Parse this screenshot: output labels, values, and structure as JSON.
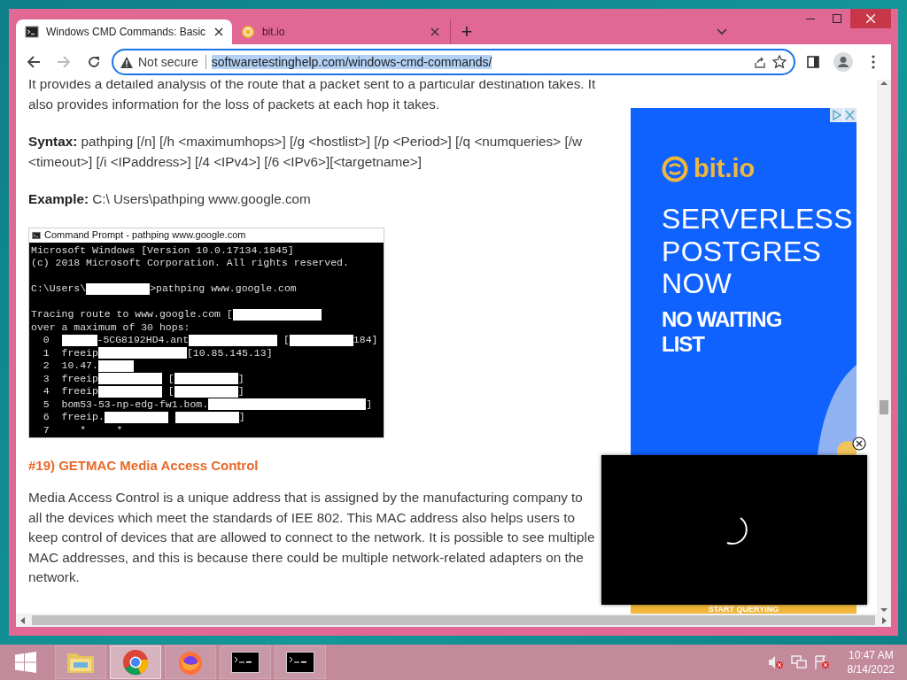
{
  "browser": {
    "tabs": [
      {
        "title": "Windows CMD Commands: Basic",
        "selected": true
      },
      {
        "title": "bit.io",
        "selected": false
      }
    ],
    "new_tab": "+",
    "address_bar": {
      "security": "Not secure",
      "url": "softwaretestinghelp.com/windows-cmd-commands/",
      "url_selected": true
    }
  },
  "article": [
    {
      "kind": "para",
      "text": "It provides a detailed analysis of the route that a packet sent to a particular destination takes. It also provides information for the loss of packets at each hop it takes."
    },
    {
      "kind": "para",
      "text": "**Syntax:** pathping [/n] [/h <maximumhops>] [/g <hostlist>] [/p <Period>] [/q <numqueries> [/w <timeout>] [/i <IPaddress>] [/4 <IPv4>] [/6 <IPv6>][<targetname>]"
    },
    {
      "kind": "para",
      "text": "**Example:** C:\\ Users\\pathping www.google.com"
    },
    {
      "kind": "screenshot",
      "title": "Command Prompt - pathping  www.google.com",
      "lines": [
        {
          "kind": "text",
          "segments": [
            {
              "kind": "text",
              "text": "Microsoft Windows [Version 10.0.17134.1845]"
            }
          ]
        },
        {
          "kind": "text",
          "segments": [
            {
              "kind": "text",
              "text": "(c) 2018 Microsoft Corporation. All rights reserved."
            }
          ]
        },
        {
          "kind": "blank"
        },
        {
          "kind": "text",
          "segments": [
            {
              "kind": "text",
              "text": "C:\\Users\\"
            },
            {
              "kind": "mask"
            },
            {
              "kind": "text",
              "text": ">pathping www.google.com"
            }
          ]
        },
        {
          "kind": "blank"
        },
        {
          "kind": "text",
          "segments": [
            {
              "kind": "text",
              "text": "Tracing route to www.google.com ["
            },
            {
              "kind": "widemask"
            }
          ]
        },
        {
          "kind": "text",
          "segments": [
            {
              "kind": "text",
              "text": "over a maximum of 30 hops:"
            }
          ]
        },
        {
          "kind": "text",
          "segments": [
            {
              "kind": "text",
              "text": "  0  "
            },
            {
              "kind": "smallmask"
            },
            {
              "kind": "text",
              "text": "-5CG8192HD4.ant"
            },
            {
              "kind": "widemask"
            },
            {
              "kind": "text",
              "text": " ["
            },
            {
              "kind": "mask"
            },
            {
              "kind": "text",
              "text": "184]"
            }
          ]
        },
        {
          "kind": "text",
          "segments": [
            {
              "kind": "text",
              "text": "  1  freeip"
            },
            {
              "kind": "widemask"
            },
            {
              "kind": "text",
              "text": "[10.85.145.13]"
            }
          ]
        },
        {
          "kind": "text",
          "segments": [
            {
              "kind": "text",
              "text": "  2  10.47."
            },
            {
              "kind": "smallmask"
            }
          ]
        },
        {
          "kind": "text",
          "segments": [
            {
              "kind": "text",
              "text": "  3  freeip"
            },
            {
              "kind": "mask"
            },
            {
              "kind": "text",
              "text": " ["
            },
            {
              "kind": "mask"
            },
            {
              "kind": "text",
              "text": "]"
            }
          ]
        },
        {
          "kind": "text",
          "segments": [
            {
              "kind": "text",
              "text": "  4  freeip"
            },
            {
              "kind": "mask"
            },
            {
              "kind": "text",
              "text": " ["
            },
            {
              "kind": "mask"
            },
            {
              "kind": "text",
              "text": "]"
            }
          ]
        },
        {
          "kind": "text",
          "segments": [
            {
              "kind": "text",
              "text": "  5  bom53-53-np-edg-fw1.bom."
            },
            {
              "kind": "longmask"
            },
            {
              "kind": "text",
              "text": "]"
            }
          ]
        },
        {
          "kind": "text",
          "segments": [
            {
              "kind": "text",
              "text": "  6  freeip."
            },
            {
              "kind": "mask"
            },
            {
              "kind": "gapmask"
            },
            {
              "kind": "text",
              "text": "]"
            }
          ]
        },
        {
          "kind": "text",
          "segments": [
            {
              "kind": "text",
              "text": "  7     *     *"
            }
          ]
        }
      ]
    },
    {
      "kind": "heading",
      "text": "#19) GETMAC Media Access Control"
    },
    {
      "kind": "para",
      "text": "Media Access Control is a unique address that is assigned by the manufacturing company to all the devices which meet the standards of IEE 802. This MAC address also helps users to keep control of devices that are allowed to connect to the network. It is possible to see multiple MAC addresses, and this is because there could be multiple network-related adapters on the network."
    }
  ],
  "ad": {
    "brand": "bit.io",
    "headline_lines": [
      "SERVERLESS",
      "POSTGRES",
      "NOW"
    ],
    "subhead": "NO WAITING LIST",
    "cta": "START QUERYING"
  },
  "taskbar": {
    "apps": [
      {
        "kind": "explorer",
        "selected": false
      },
      {
        "kind": "chrome",
        "selected": true
      },
      {
        "kind": "firefox",
        "selected": false
      },
      {
        "kind": "cmd",
        "selected": false
      },
      {
        "kind": "cmd",
        "selected": false
      }
    ],
    "clock": {
      "time": "10:47 AM",
      "date": "8/14/2022"
    }
  }
}
